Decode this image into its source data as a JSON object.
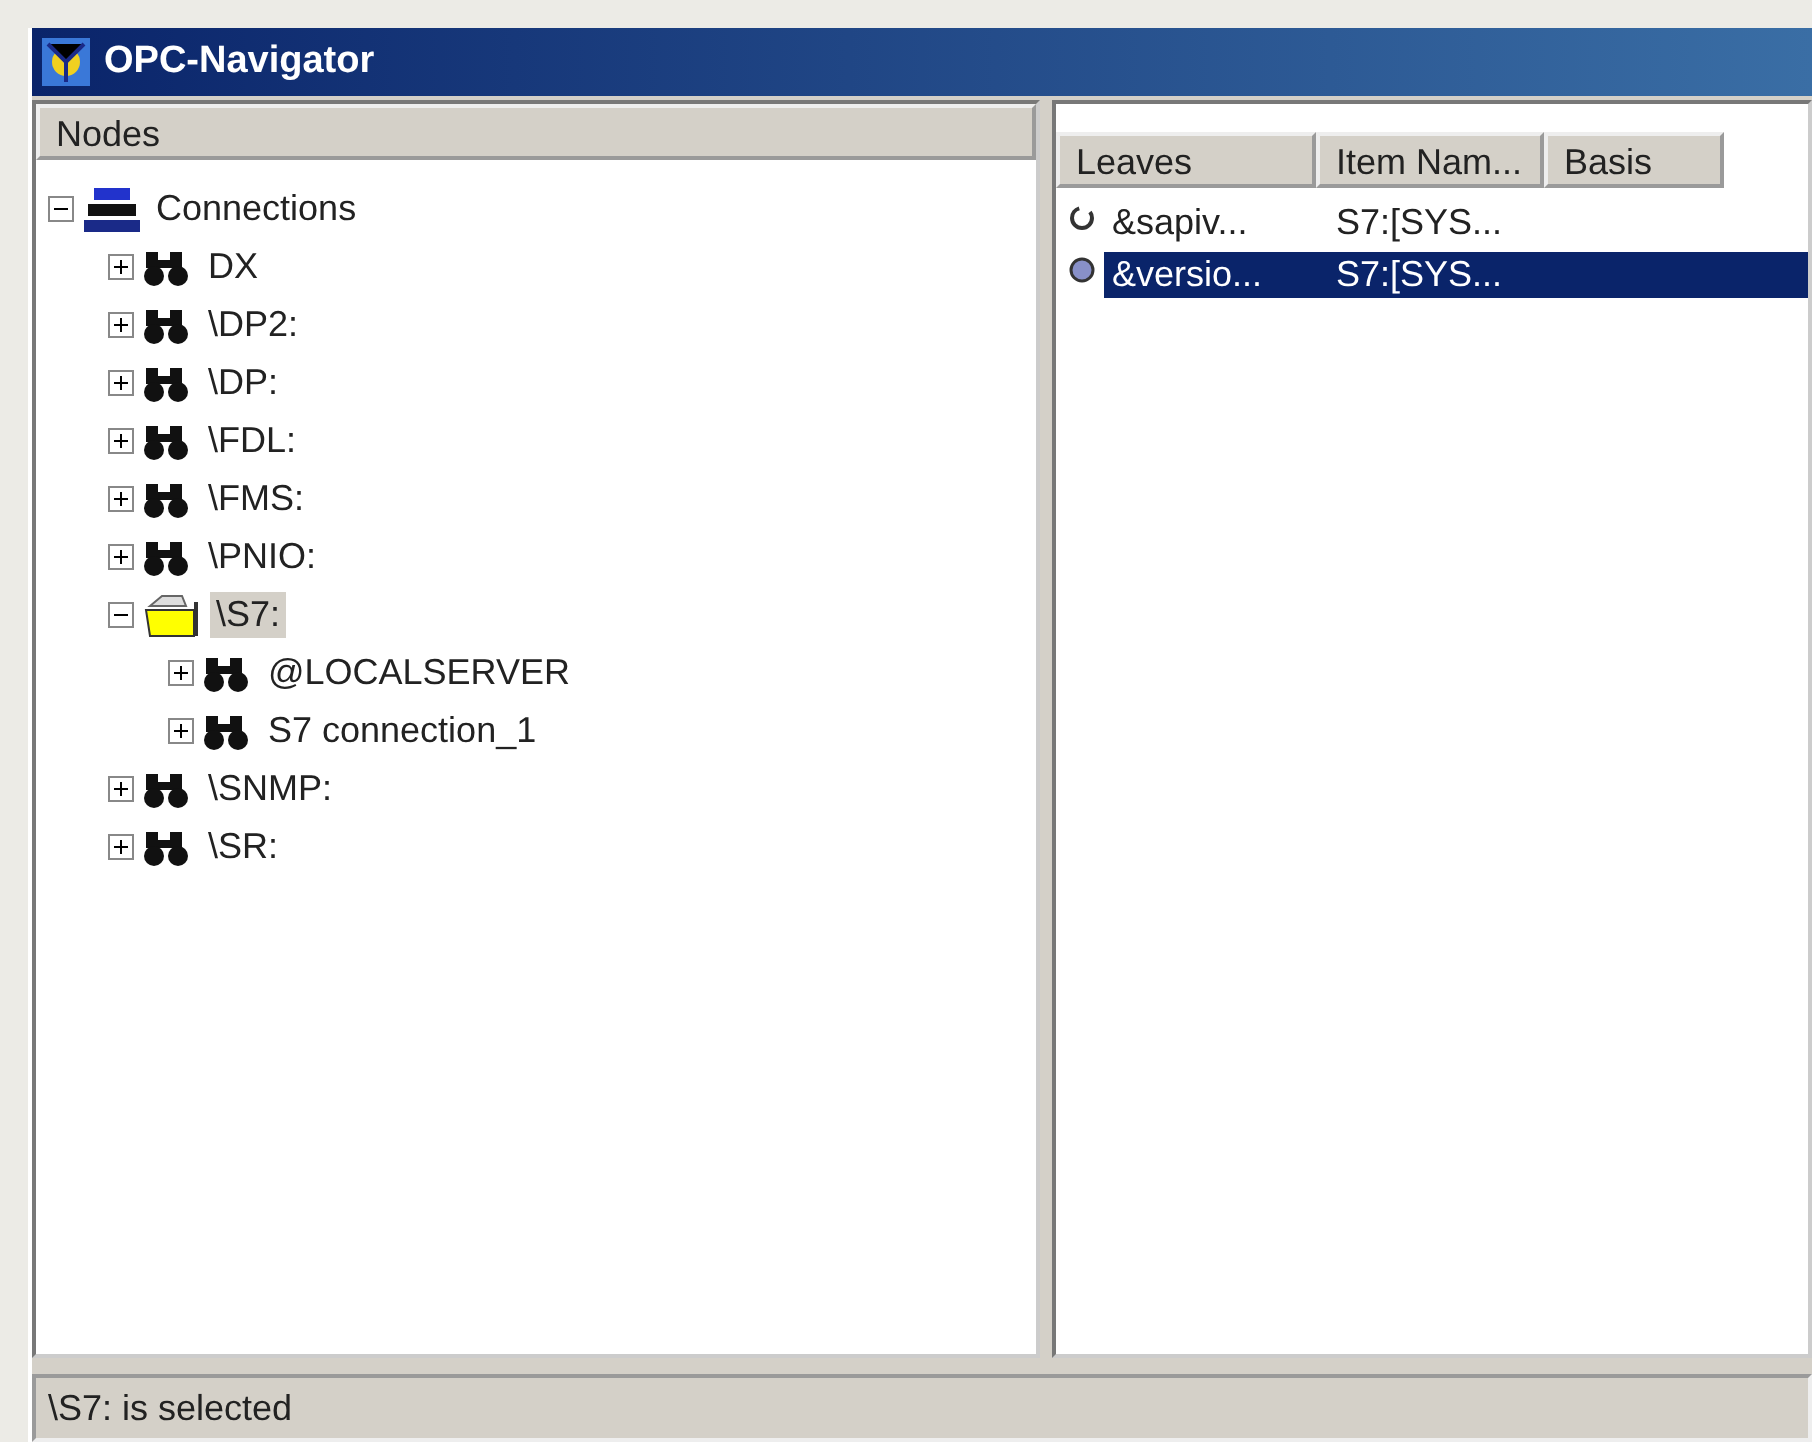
{
  "window": {
    "title": "OPC-Navigator"
  },
  "tree": {
    "header": "Nodes",
    "items": [
      {
        "label": "Connections",
        "kind": "server",
        "expanded": true,
        "selected": false,
        "children": [
          {
            "label": "DX",
            "kind": "binoculars",
            "expanded": false,
            "selected": false
          },
          {
            "label": "\\DP2:",
            "kind": "binoculars",
            "expanded": false,
            "selected": false
          },
          {
            "label": "\\DP:",
            "kind": "binoculars",
            "expanded": false,
            "selected": false
          },
          {
            "label": "\\FDL:",
            "kind": "binoculars",
            "expanded": false,
            "selected": false
          },
          {
            "label": "\\FMS:",
            "kind": "binoculars",
            "expanded": false,
            "selected": false
          },
          {
            "label": "\\PNIO:",
            "kind": "binoculars",
            "expanded": false,
            "selected": false
          },
          {
            "label": "\\S7:",
            "kind": "folder",
            "expanded": true,
            "selected": true,
            "children": [
              {
                "label": "@LOCALSERVER",
                "kind": "binoculars",
                "expanded": false,
                "selected": false
              },
              {
                "label": "S7 connection_1",
                "kind": "binoculars",
                "expanded": false,
                "selected": false
              }
            ]
          },
          {
            "label": "\\SNMP:",
            "kind": "binoculars",
            "expanded": false,
            "selected": false
          },
          {
            "label": "\\SR:",
            "kind": "binoculars",
            "expanded": false,
            "selected": false
          }
        ]
      }
    ]
  },
  "leaves": {
    "columns": [
      "Leaves",
      "Item Nam...",
      "Basis"
    ],
    "rows": [
      {
        "kind": "ring",
        "cells": [
          "&sapiv...",
          "S7:[SYS..."
        ],
        "selected": false
      },
      {
        "kind": "dot",
        "cells": [
          "&versio...",
          "S7:[SYS..."
        ],
        "selected": true
      }
    ]
  },
  "status_bar": "\\S7: is selected"
}
